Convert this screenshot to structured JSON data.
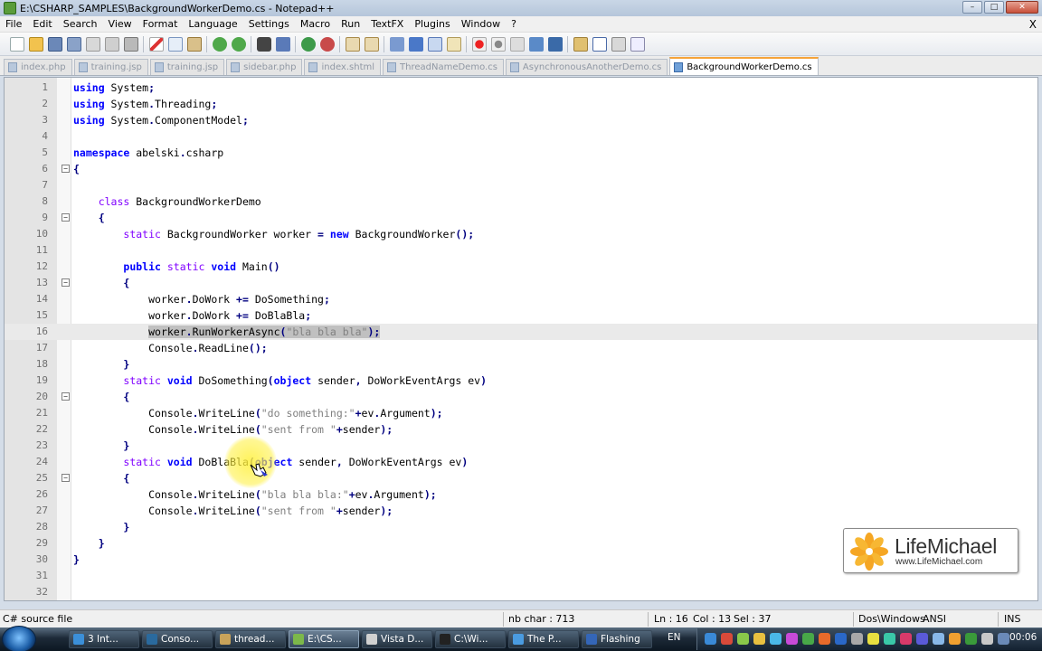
{
  "window": {
    "title": "E:\\CSHARP_SAMPLES\\BackgroundWorkerDemo.cs - Notepad++",
    "close_x": "X"
  },
  "menu": [
    "File",
    "Edit",
    "Search",
    "View",
    "Format",
    "Language",
    "Settings",
    "Macro",
    "Run",
    "TextFX",
    "Plugins",
    "Window",
    "?"
  ],
  "tabs": [
    {
      "label": "index.php",
      "active": false
    },
    {
      "label": "training.jsp",
      "active": false
    },
    {
      "label": "training.jsp",
      "active": false
    },
    {
      "label": "sidebar.php",
      "active": false
    },
    {
      "label": "index.shtml",
      "active": false
    },
    {
      "label": "ThreadNameDemo.cs",
      "active": false
    },
    {
      "label": "AsynchronousAnotherDemo.cs",
      "active": false
    },
    {
      "label": "BackgroundWorkerDemo.cs",
      "active": true
    }
  ],
  "editor": {
    "current_line": 16,
    "lines": [
      {
        "n": "1",
        "t": "using System;"
      },
      {
        "n": "2",
        "t": "using System.Threading;"
      },
      {
        "n": "3",
        "t": "using System.ComponentModel;"
      },
      {
        "n": "4",
        "t": ""
      },
      {
        "n": "5",
        "t": "namespace abelski.csharp"
      },
      {
        "n": "6",
        "t": "{"
      },
      {
        "n": "7",
        "t": ""
      },
      {
        "n": "8",
        "t": "    class BackgroundWorkerDemo"
      },
      {
        "n": "9",
        "t": "    {"
      },
      {
        "n": "10",
        "t": "        static BackgroundWorker worker = new BackgroundWorker();"
      },
      {
        "n": "11",
        "t": ""
      },
      {
        "n": "12",
        "t": "        public static void Main()"
      },
      {
        "n": "13",
        "t": "        {"
      },
      {
        "n": "14",
        "t": "            worker.DoWork += DoSomething;"
      },
      {
        "n": "15",
        "t": "            worker.DoWork += DoBlaBla;"
      },
      {
        "n": "16",
        "t": "            worker.RunWorkerAsync(\"bla bla bla\");"
      },
      {
        "n": "17",
        "t": "            Console.ReadLine();"
      },
      {
        "n": "18",
        "t": "        }"
      },
      {
        "n": "19",
        "t": "        static void DoSomething(object sender, DoWorkEventArgs ev)"
      },
      {
        "n": "20",
        "t": "        {"
      },
      {
        "n": "21",
        "t": "            Console.WriteLine(\"do something:\"+ev.Argument);"
      },
      {
        "n": "22",
        "t": "            Console.WriteLine(\"sent from \"+sender);"
      },
      {
        "n": "23",
        "t": "        }"
      },
      {
        "n": "24",
        "t": "        static void DoBlaBla(object sender, DoWorkEventArgs ev)"
      },
      {
        "n": "25",
        "t": "        {"
      },
      {
        "n": "26",
        "t": "            Console.WriteLine(\"bla bla bla:\"+ev.Argument);"
      },
      {
        "n": "27",
        "t": "            Console.WriteLine(\"sent from \"+sender);"
      },
      {
        "n": "28",
        "t": "        }"
      },
      {
        "n": "29",
        "t": "    }"
      },
      {
        "n": "30",
        "t": "}"
      },
      {
        "n": "31",
        "t": ""
      },
      {
        "n": "32",
        "t": ""
      }
    ]
  },
  "logo": {
    "name": "LifeMichael",
    "url": "www.LifeMichael.com"
  },
  "status": {
    "filetype": "C# source file",
    "chars": "nb char : 713",
    "ln": "Ln : 16",
    "col": "Col : 13",
    "sel": "Sel : 37",
    "eol": "Dos\\Windows",
    "encoding": "ANSI",
    "mode": "INS"
  },
  "taskbar": {
    "buttons": [
      {
        "label": "3 Int...",
        "color": "#3b8fd8"
      },
      {
        "label": "Conso...",
        "color": "#2a6a9e"
      },
      {
        "label": "thread...",
        "color": "#c9a35a"
      },
      {
        "label": "E:\\CS...",
        "color": "#7cb84a",
        "active": true
      },
      {
        "label": "Vista D...",
        "color": "#d0d0d0"
      },
      {
        "label": "C:\\Wi...",
        "color": "#222222"
      },
      {
        "label": "The P...",
        "color": "#4a9be0"
      },
      {
        "label": "Flashing",
        "color": "#3466b8"
      }
    ],
    "lang": "EN",
    "time": "00:06"
  }
}
